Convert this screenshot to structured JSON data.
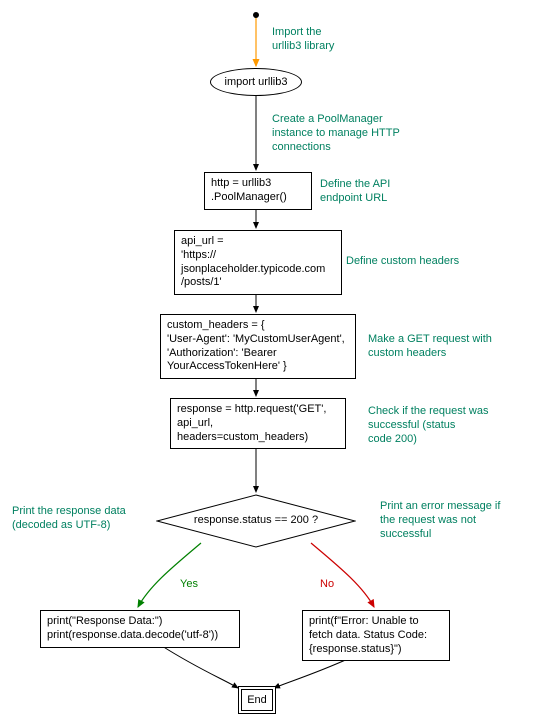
{
  "chart_data": {
    "type": "flowchart",
    "nodes": [
      {
        "id": "start",
        "shape": "point"
      },
      {
        "id": "import",
        "shape": "ellipse",
        "text": "import urllib3"
      },
      {
        "id": "pool",
        "shape": "box",
        "text": "http = urllib3\n.PoolManager()"
      },
      {
        "id": "apiurl",
        "shape": "box",
        "text": "api_url =\n'https://\njsonplaceholder.typicode.com\n/posts/1'"
      },
      {
        "id": "headers",
        "shape": "box",
        "text": "custom_headers = {\n'User-Agent': 'MyCustomUserAgent',\n'Authorization': 'Bearer\nYourAccessTokenHere' }"
      },
      {
        "id": "request",
        "shape": "box",
        "text": "response = http.request('GET',\napi_url,\nheaders=custom_headers)"
      },
      {
        "id": "decision",
        "shape": "diamond",
        "text": "response.status == 200 ?"
      },
      {
        "id": "success",
        "shape": "box",
        "text": "print(\"Response Data:\")\nprint(response.data.decode('utf-8'))"
      },
      {
        "id": "error",
        "shape": "box",
        "text": "print(f\"Error: Unable to\nfetch data. Status Code:\n{response.status}\")"
      },
      {
        "id": "end",
        "shape": "doublebox",
        "text": "End"
      }
    ],
    "edges": [
      {
        "from": "start",
        "to": "import",
        "color": "orange"
      },
      {
        "from": "import",
        "to": "pool"
      },
      {
        "from": "pool",
        "to": "apiurl"
      },
      {
        "from": "apiurl",
        "to": "headers"
      },
      {
        "from": "headers",
        "to": "request"
      },
      {
        "from": "request",
        "to": "decision"
      },
      {
        "from": "decision",
        "to": "success",
        "label": "Yes",
        "color": "green"
      },
      {
        "from": "decision",
        "to": "error",
        "label": "No",
        "color": "red"
      },
      {
        "from": "success",
        "to": "end"
      },
      {
        "from": "error",
        "to": "end"
      }
    ],
    "annotations": [
      {
        "target": "start",
        "text": "Import the\nurllib3 library"
      },
      {
        "target": "pool_edge",
        "text": "Create a PoolManager\ninstance to manage HTTP\nconnections"
      },
      {
        "target": "pool",
        "text": "Define the API\nendpoint URL"
      },
      {
        "target": "apiurl",
        "text": "Define custom headers"
      },
      {
        "target": "headers",
        "text": "Make a GET request with\ncustom headers"
      },
      {
        "target": "request",
        "text": "Check if the request was\nsuccessful (status\ncode 200)"
      },
      {
        "target": "decision_no",
        "text": "Print an error message if\nthe request was not\nsuccessful"
      },
      {
        "target": "decision_yes",
        "text": "Print the response data\n(decoded as UTF-8)"
      }
    ]
  },
  "labels": {
    "import": "import urllib3",
    "pool_l1": "http = urllib3",
    "pool_l2": ".PoolManager()",
    "api_l1": "api_url =",
    "api_l2": "'https://",
    "api_l3": "jsonplaceholder.typicode.com",
    "api_l4": "/posts/1'",
    "hdr_l1": "custom_headers = {",
    "hdr_l2": "'User-Agent': 'MyCustomUserAgent',",
    "hdr_l3": "'Authorization': 'Bearer",
    "hdr_l4": "YourAccessTokenHere' }",
    "req_l1": "response = http.request('GET',",
    "req_l2": "api_url,",
    "req_l3": "headers=custom_headers)",
    "decision": "response.status == 200 ?",
    "suc_l1": "print(\"Response Data:\")",
    "suc_l2": "print(response.data.decode('utf-8'))",
    "err_l1": "print(f\"Error: Unable to",
    "err_l2": "fetch data. Status Code:",
    "err_l3": "{response.status}\")",
    "end": "End",
    "yes": "Yes",
    "no": "No",
    "ann_start": "Import the\nurllib3 library",
    "ann_poolmgr": "Create a PoolManager\ninstance to manage HTTP\nconnections",
    "ann_api": "Define the API\nendpoint URL",
    "ann_headers": "Define custom headers",
    "ann_get": "Make a GET request with\ncustom headers",
    "ann_check": "Check if the request was\nsuccessful (status\ncode 200)",
    "ann_err": "Print an error message if\nthe request was not\nsuccessful",
    "ann_suc": "Print the response data\n(decoded as UTF-8)"
  }
}
